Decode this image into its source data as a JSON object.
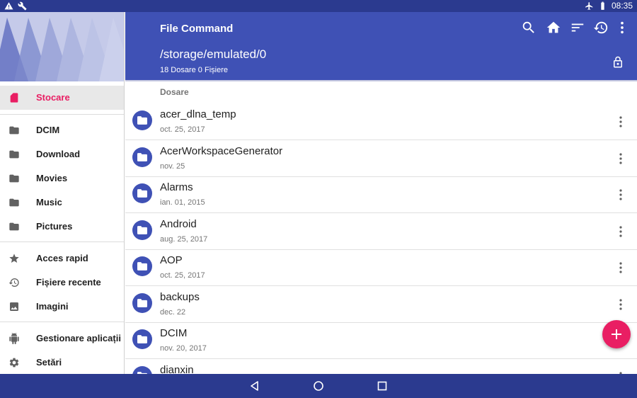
{
  "status_bar": {
    "time": "08:35",
    "left_icons": [
      "warning-icon",
      "wrench-icon"
    ],
    "right_icons": [
      "airplane-icon",
      "battery-icon"
    ]
  },
  "drawer": {
    "storage": {
      "label": "Stocare",
      "icon": "sd-card-icon"
    },
    "folders": [
      {
        "label": "DCIM",
        "icon": "folder-icon"
      },
      {
        "label": "Download",
        "icon": "folder-icon"
      },
      {
        "label": "Movies",
        "icon": "folder-icon"
      },
      {
        "label": "Music",
        "icon": "folder-icon"
      },
      {
        "label": "Pictures",
        "icon": "folder-icon"
      }
    ],
    "shortcuts": [
      {
        "label": "Acces rapid",
        "icon": "star-icon"
      },
      {
        "label": "Fișiere recente",
        "icon": "history-icon"
      },
      {
        "label": "Imagini",
        "icon": "image-icon"
      }
    ],
    "tools": [
      {
        "label": "Gestionare aplicații",
        "icon": "android-icon"
      },
      {
        "label": "Setări",
        "icon": "gear-icon"
      }
    ]
  },
  "appbar": {
    "title": "File Command",
    "path": "/storage/emulated/0",
    "counts": "18 Dosare 0 Fișiere",
    "actions": [
      "search-icon",
      "home-icon",
      "sort-icon",
      "history-icon",
      "more-vert-icon"
    ]
  },
  "list": {
    "section_label": "Dosare",
    "items": [
      {
        "name": "acer_dlna_temp",
        "date": "oct. 25, 2017"
      },
      {
        "name": "AcerWorkspaceGenerator",
        "date": "nov. 25"
      },
      {
        "name": "Alarms",
        "date": "ian. 01, 2015"
      },
      {
        "name": "Android",
        "date": "aug. 25, 2017"
      },
      {
        "name": "AOP",
        "date": "oct. 25, 2017"
      },
      {
        "name": "backups",
        "date": "dec. 22"
      },
      {
        "name": "DCIM",
        "date": "nov. 20, 2017"
      },
      {
        "name": "dianxin",
        "date": ""
      }
    ]
  },
  "colors": {
    "primary": "#3f51b5",
    "primary_dark": "#2b3a8f",
    "accent": "#e91e63"
  }
}
